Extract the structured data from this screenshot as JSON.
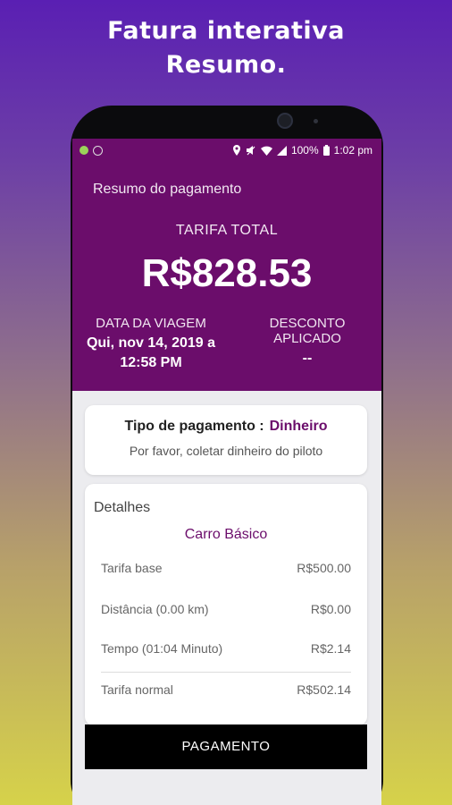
{
  "promo": {
    "line1": "Fatura interativa",
    "line2": "Resumo."
  },
  "statusbar": {
    "battery": "100%",
    "time": "1:02 pm",
    "icons": [
      "android-dot-icon",
      "alarm-icon",
      "location-icon",
      "mute-icon",
      "wifi-icon",
      "signal-icon",
      "battery-icon"
    ]
  },
  "header": {
    "title": "Resumo do pagamento",
    "total_label": "TARIFA TOTAL",
    "total_amount": "R$828.53",
    "trip_date_label": "DATA DA VIAGEM",
    "trip_date_value": "Qui, nov 14, 2019 a 12:58 PM",
    "discount_label": "DESCONTO APLICADO",
    "discount_value": "--"
  },
  "payment": {
    "type_label": "Tipo de pagamento :",
    "type_value": "Dinheiro",
    "note": "Por favor, coletar dinheiro do piloto"
  },
  "details": {
    "title": "Detalhes",
    "category": "Carro Básico",
    "rows": [
      {
        "label": "Tarifa base",
        "value": "R$500.00"
      },
      {
        "label": "Distância (0.00 km)",
        "value": "R$0.00"
      },
      {
        "label": "Tempo (01:04 Minuto)",
        "value": "R$2.14"
      },
      {
        "label": "Tarifa normal",
        "value": "R$502.14"
      }
    ]
  },
  "button": {
    "label": "PAGAMENTO"
  },
  "colors": {
    "brand": "#6b0d6b",
    "button": "#000000"
  }
}
